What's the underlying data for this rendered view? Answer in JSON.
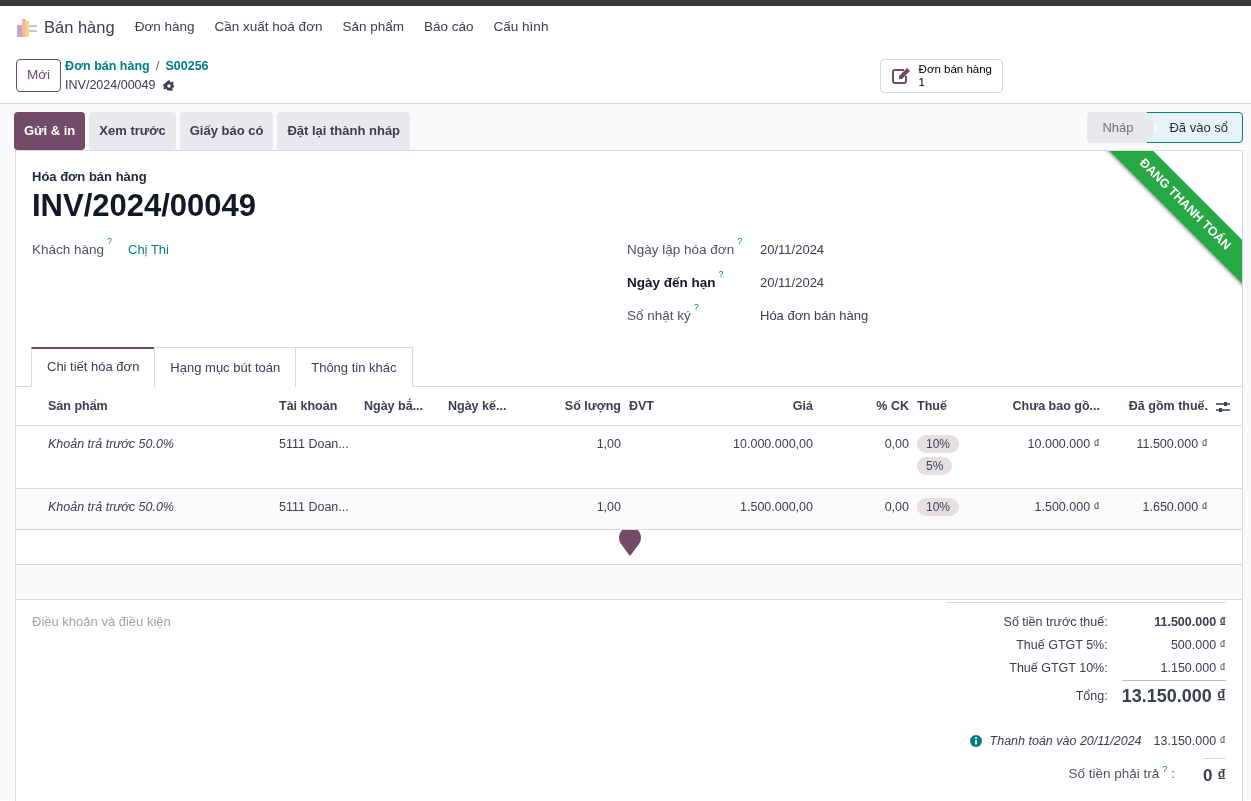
{
  "app": {
    "name": "Bán hàng",
    "menu": [
      "Đơn hàng",
      "Cần xuất hoá đơn",
      "Sản phẩm",
      "Báo cáo",
      "Cấu hình"
    ]
  },
  "control": {
    "new_button": "Mới",
    "breadcrumbs": [
      "Đơn bán hàng",
      "S00256"
    ],
    "breadcrumb_separator": "/",
    "record": "INV/2024/00049",
    "smart_button": {
      "label": "Đơn bán hàng",
      "count": "1"
    }
  },
  "actions": [
    {
      "label": "Gửi & in",
      "primary": true
    },
    {
      "label": "Xem trước",
      "primary": false
    },
    {
      "label": "Giấy báo có",
      "primary": false
    },
    {
      "label": "Đặt lại thành nháp",
      "primary": false
    }
  ],
  "statuses": [
    {
      "label": "Nháp",
      "selected": false
    },
    {
      "label": "Đã vào sổ",
      "selected": true
    }
  ],
  "ribbon": "ĐANG THANH TOÁN",
  "sheet": {
    "type": "Hóa đơn bán hàng",
    "number": "INV/2024/00049"
  },
  "left_fields": [
    {
      "label": "Khách hàng",
      "help": "?",
      "value": "Chị Thi",
      "required": false,
      "link": true
    }
  ],
  "right_fields": [
    {
      "label": "Ngày lập hóa đơn",
      "help": "?",
      "value": "20/11/2024",
      "required": false,
      "link": false
    },
    {
      "label": "Ngày đến hạn",
      "help": "?",
      "value": "20/11/2024",
      "required": true,
      "link": false
    },
    {
      "label": "Sổ nhật ký",
      "help": "?",
      "value": "Hóa đơn bán hàng",
      "required": false,
      "link": false
    }
  ],
  "tabs": [
    {
      "label": "Chi tiết hóa đơn",
      "selected": true
    },
    {
      "label": "Hạng mục bút toán",
      "selected": false
    },
    {
      "label": "Thông tin khác",
      "selected": false
    }
  ],
  "table": {
    "columns": [
      "Sản phẩm",
      "Tài khoản",
      "Ngày bắ...",
      "Ngày kế...",
      "Số lượng",
      "ĐVT",
      "Giá",
      "% CK",
      "Thuế",
      "Chưa bao gồ...",
      "Đã gồm thuế."
    ],
    "rows": [
      {
        "cells": [
          "Khoản trả trước 50.0%",
          "5111 Doan...",
          "",
          "",
          "1,00",
          "",
          "10.000.000,00",
          "0,00",
          "",
          "10.000.000 ₫",
          "11.500.000 ₫"
        ],
        "taxes": [
          "10%",
          "5%"
        ]
      },
      {
        "cells": [
          "Khoản trả trước 50.0%",
          "5111 Doan...",
          "",
          "",
          "1,00",
          "",
          "1.500.000,00",
          "0,00",
          "",
          "1.500.000 ₫",
          "1.650.000 ₫"
        ],
        "taxes": [
          "10%"
        ]
      }
    ]
  },
  "terms_placeholder": "Điều khoản và điều kiện",
  "totals": [
    {
      "kind": "subtotal",
      "label": "Số tiền trước thuế:",
      "value": "11.500.000 ₫"
    },
    {
      "kind": "tax",
      "label": "Thuế GTGT 5%:",
      "value": "500.000 ₫"
    },
    {
      "kind": "tax",
      "label": "Thuế GTGT 10%:",
      "value": "1.150.000 ₫"
    },
    {
      "kind": "total",
      "label": "Tổng:",
      "value": "13.150.000 ₫"
    }
  ],
  "payment": {
    "label": "Thanh toán vào 20/11/2024",
    "value": "13.150.000 ₫"
  },
  "amount_due": {
    "label": "Số tiền phải trả",
    "help": "?",
    "colon": ":",
    "value": "0 ₫"
  }
}
